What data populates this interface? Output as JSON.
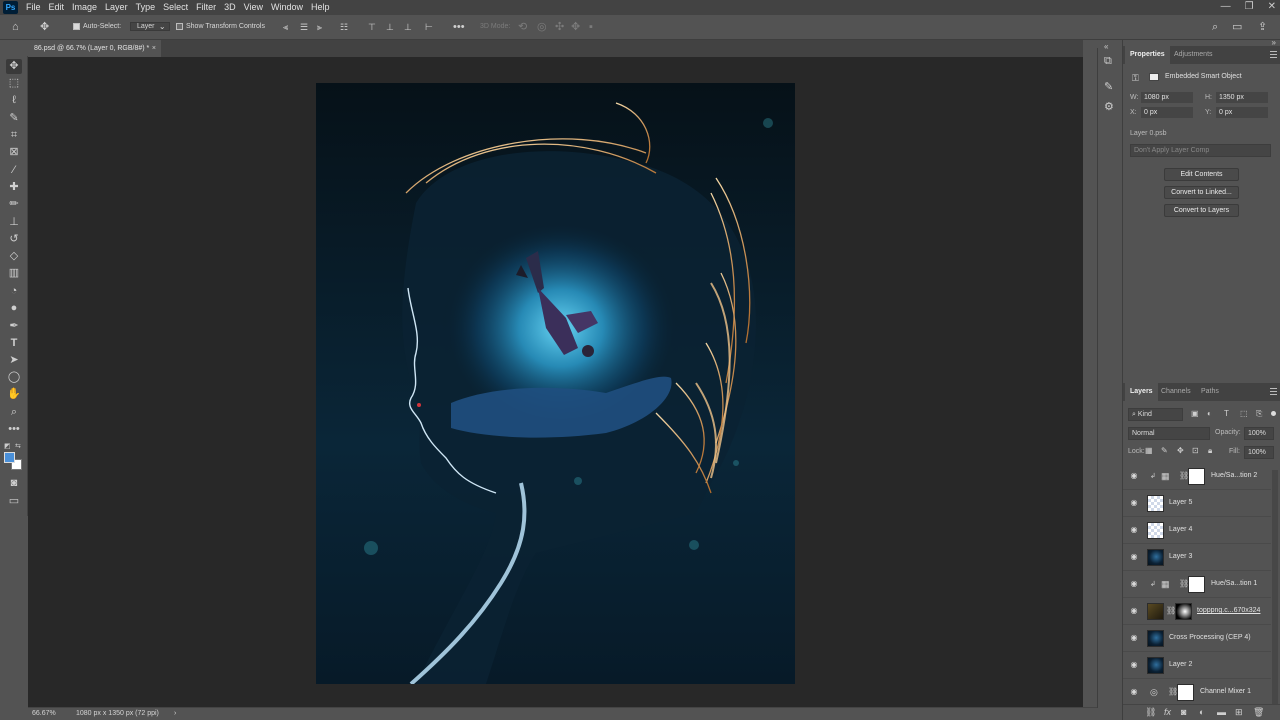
{
  "app": {
    "logo": "Ps"
  },
  "menu": [
    "File",
    "Edit",
    "Image",
    "Layer",
    "Type",
    "Select",
    "Filter",
    "3D",
    "View",
    "Window",
    "Help"
  ],
  "window_controls": {
    "minimize": "—",
    "restore": "❐",
    "close": "✕"
  },
  "options_bar": {
    "auto_select_label": "Auto-Select:",
    "auto_select_checked": true,
    "target_value": "Layer",
    "show_transform_label": "Show Transform Controls",
    "more_label": "•••",
    "mode_3d_label": "3D Mode:"
  },
  "document": {
    "tab_title": "86.psd @ 66.7% (Layer 0, RGB/8#) *",
    "close": "×"
  },
  "status": {
    "zoom": "66.67%",
    "doc_info": "1080 px x 1350 px (72 ppi)",
    "arrow": "›"
  },
  "properties_panel": {
    "tabs": [
      "Properties",
      "Adjustments"
    ],
    "object_type": "Embedded Smart Object",
    "w_label": "W:",
    "w_value": "1080 px",
    "h_label": "H:",
    "h_value": "1350 px",
    "x_label": "X:",
    "x_value": "0 px",
    "y_label": "Y:",
    "y_value": "0 px",
    "file_name": "Layer 0.psb",
    "layer_comp": "Don't Apply Layer Comp",
    "buttons": [
      "Edit Contents",
      "Convert to Linked...",
      "Convert to Layers"
    ]
  },
  "layers_panel": {
    "tabs": [
      "Layers",
      "Channels",
      "Paths"
    ],
    "filter_kind": "Kind",
    "blend_mode": "Normal",
    "opacity_label": "Opacity:",
    "opacity_value": "100%",
    "lock_label": "Lock:",
    "fill_label": "Fill:",
    "fill_value": "100%",
    "layers": [
      {
        "name": "Hue/Sa...tion 2",
        "type": "adjustment"
      },
      {
        "name": "Layer 5",
        "type": "pixel-transparent"
      },
      {
        "name": "Layer 4",
        "type": "pixel-transparent"
      },
      {
        "name": "Layer 3",
        "type": "pixel-dark"
      },
      {
        "name": "Hue/Sa...tion 1",
        "type": "adjustment"
      },
      {
        "name": "topppng.c...670x324",
        "type": "smart-mask"
      },
      {
        "name": "Cross Processing (CEP 4)",
        "type": "pixel-dark"
      },
      {
        "name": "Layer 2",
        "type": "pixel-dark"
      },
      {
        "name": "Channel Mixer 1",
        "type": "adjustment-round"
      }
    ],
    "footer_icons": [
      "link-icon",
      "fx-icon",
      "mask-icon",
      "adjustment-icon",
      "folder-icon",
      "new-layer-icon",
      "trash-icon"
    ]
  },
  "colors": {
    "accent": "#31a8ff",
    "foreground": "#4a90d9",
    "background": "#ffffff"
  }
}
